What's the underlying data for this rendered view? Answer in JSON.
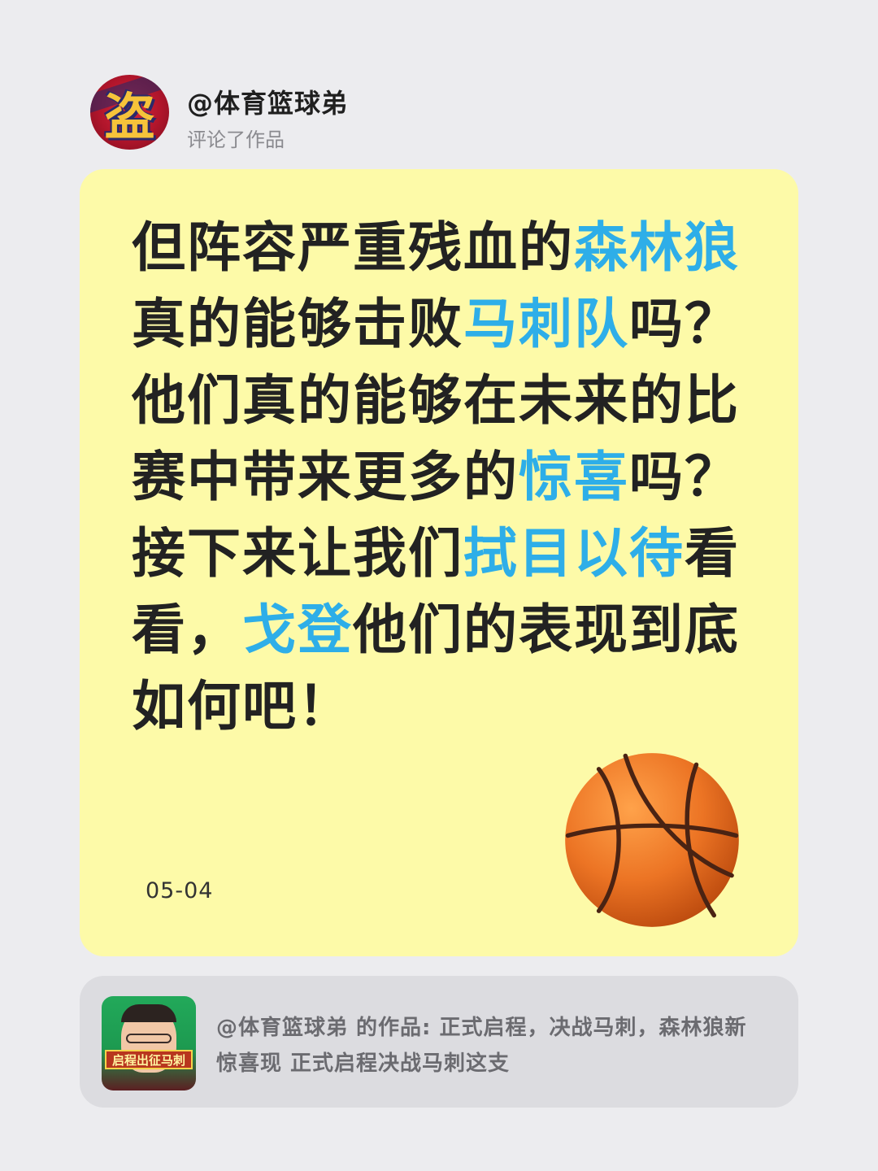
{
  "header": {
    "avatar_glyph": "盗",
    "username": "@体育篮球弟",
    "action": "评论了作品"
  },
  "comment": {
    "segments": [
      {
        "text": "但阵容严重残血的",
        "highlight": false
      },
      {
        "text": "森林狼",
        "highlight": true
      },
      {
        "text": "真的能够击败",
        "highlight": false
      },
      {
        "text": "马刺队",
        "highlight": true
      },
      {
        "text": "吗？他们真的能够在未来的比赛中带来更多的",
        "highlight": false
      },
      {
        "text": "惊喜",
        "highlight": true
      },
      {
        "text": "吗？接下来让我们",
        "highlight": false
      },
      {
        "text": "拭目以待",
        "highlight": true
      },
      {
        "text": "看看，",
        "highlight": false
      },
      {
        "text": "戈登",
        "highlight": true
      },
      {
        "text": "他们的表现到底如何吧！",
        "highlight": false
      }
    ],
    "date": "05-04",
    "emoji_icon": "basketball-icon"
  },
  "reference": {
    "thumb_banner": "启程出征马刺",
    "text": "@体育篮球弟 的作品: 正式启程，决战马刺，森林狼新惊喜现 正式启程决战马刺这支"
  },
  "colors": {
    "background": "#ececef",
    "card": "#fdfaa8",
    "highlight": "#2eaee8",
    "reference_card": "#dcdce0"
  }
}
